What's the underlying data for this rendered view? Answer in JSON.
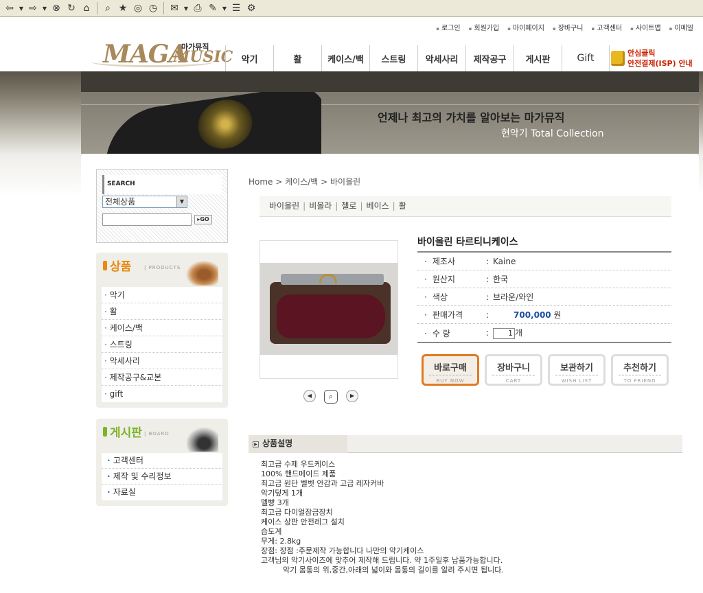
{
  "header": {
    "top_links": [
      "로그인",
      "회원가입",
      "마이페이지",
      "장바구니",
      "고객센터",
      "사이트맵",
      "이메일"
    ],
    "logo": {
      "main": "MAGA",
      "sub": "MUSIC",
      "korean": "마가뮤직"
    },
    "gnb": [
      "악기",
      "활",
      "케이스/백",
      "스트링",
      "악세사리",
      "제작공구",
      "게시판",
      "Gift"
    ],
    "safe_pay": {
      "line1": "안심클릭",
      "line2": "안전결제(ISP) 안내"
    }
  },
  "banner": {
    "title": "언제나  최고의 가치를 알아보는 마가뮤직",
    "subtitle": "현악기 Total Collection"
  },
  "sidebar": {
    "search": {
      "label": "SEARCH",
      "category_selected": "전체상품",
      "go_label": "GO"
    },
    "products": {
      "title": "상품",
      "en": "| PRODUCTS",
      "items": [
        "악기",
        "활",
        "케이스/백",
        "스트링",
        "악세사리",
        "제작공구&교본",
        "gift"
      ]
    },
    "board": {
      "title": "게시판",
      "en": "| BOARD",
      "items": [
        "고객센터",
        "제작 및 수리정보",
        "자료실"
      ]
    }
  },
  "main": {
    "breadcrumb": "Home > 케이스/백 > 바이올린",
    "subnav": [
      "바이올린",
      "비올라",
      "첼로",
      "베이스",
      "활"
    ],
    "product": {
      "name": "바이올린 타르티니케이스",
      "specs": [
        {
          "key": "제조사",
          "value": "Kaine"
        },
        {
          "key": "원산지",
          "value": "한국"
        },
        {
          "key": "색상",
          "value": "브라운/와인"
        }
      ],
      "price_label": "판매가격",
      "price": "700,000",
      "price_unit": "원",
      "qty_label": "수 량",
      "qty": "1",
      "qty_unit": "개"
    },
    "buttons": [
      {
        "kr": "바로구매",
        "en": "BUY NOW"
      },
      {
        "kr": "장바구니",
        "en": "CART"
      },
      {
        "kr": "보관하기",
        "en": "WISH LIST"
      },
      {
        "kr": "추천하기",
        "en": "TO FRIEND"
      }
    ],
    "description": {
      "heading": "상품설명",
      "lines": [
        "최고급 수제 우드케이스",
        "100% 핸드메이드 제품",
        "최고급 원단 벨벳 안감과 고급 레자커바",
        "악기덮게 1개",
        "멜빵 3개",
        "최고급 다이얼잠금장치",
        "케이스 상판 안전레그 설치",
        "습도계",
        "무게: 2.8kg",
        "장점: 장점 :주문제작 가능합니다 나만의 악기케이스",
        "고객님의 악기사이즈에 맞추어 제작해 드립니다. 약 1주일후 납품가능합니다."
      ],
      "indent_line": "악기 몸통의 위,중간,아래의 넓이와 몸통의 길이를 알려 주시면 됩니다."
    }
  }
}
